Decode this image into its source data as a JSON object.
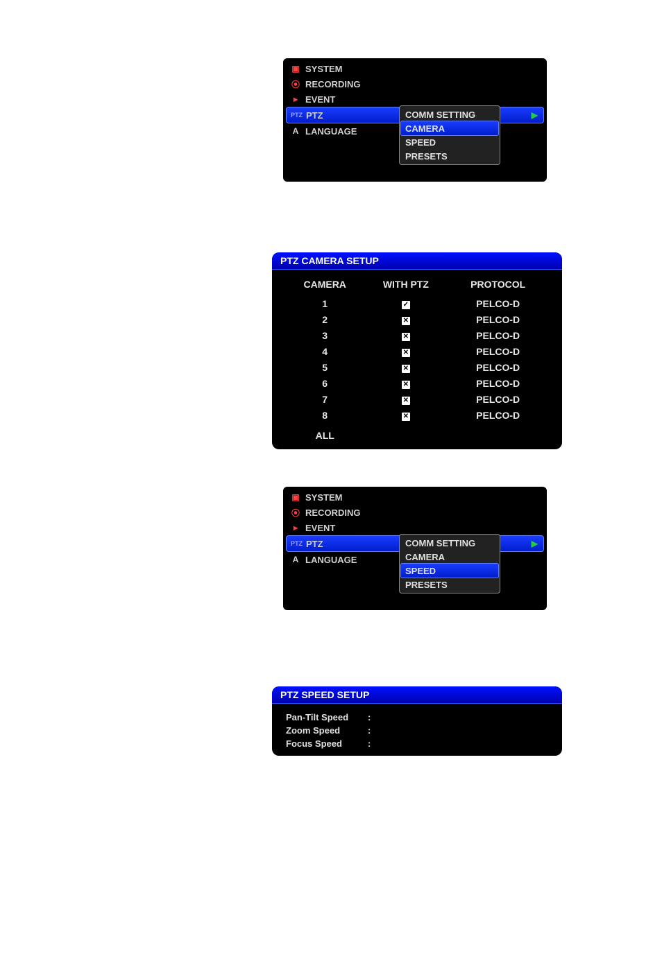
{
  "menu1": {
    "items": [
      {
        "label": "SYSTEM"
      },
      {
        "label": "RECORDING"
      },
      {
        "label": "EVENT"
      },
      {
        "label": "PTZ"
      },
      {
        "label": "LANGUAGE"
      }
    ],
    "submenu": [
      {
        "label": "COMM SETTING"
      },
      {
        "label": "CAMERA"
      },
      {
        "label": "SPEED"
      },
      {
        "label": "PRESETS"
      }
    ]
  },
  "camera_setup": {
    "title": "PTZ CAMERA SETUP",
    "headers": {
      "camera": "CAMERA",
      "with": "WITH PTZ",
      "protocol": "PROTOCOL"
    },
    "rows": [
      {
        "cam": "1",
        "with": "✓",
        "protocol": "PELCO-D"
      },
      {
        "cam": "2",
        "with": "✕",
        "protocol": "PELCO-D"
      },
      {
        "cam": "3",
        "with": "✕",
        "protocol": "PELCO-D"
      },
      {
        "cam": "4",
        "with": "✕",
        "protocol": "PELCO-D"
      },
      {
        "cam": "5",
        "with": "✕",
        "protocol": "PELCO-D"
      },
      {
        "cam": "6",
        "with": "✕",
        "protocol": "PELCO-D"
      },
      {
        "cam": "7",
        "with": "✕",
        "protocol": "PELCO-D"
      },
      {
        "cam": "8",
        "with": "✕",
        "protocol": "PELCO-D"
      }
    ],
    "all": "ALL"
  },
  "menu2": {
    "items": [
      {
        "label": "SYSTEM"
      },
      {
        "label": "RECORDING"
      },
      {
        "label": "EVENT"
      },
      {
        "label": "PTZ"
      },
      {
        "label": "LANGUAGE"
      }
    ],
    "submenu": [
      {
        "label": "COMM SETTING"
      },
      {
        "label": "CAMERA"
      },
      {
        "label": "SPEED"
      },
      {
        "label": "PRESETS"
      }
    ]
  },
  "speed_setup": {
    "title": "PTZ SPEED SETUP",
    "rows": [
      {
        "label": "Pan-Tilt Speed",
        "sep": ":"
      },
      {
        "label": "Zoom Speed",
        "sep": ":"
      },
      {
        "label": "Focus Speed",
        "sep": ":"
      }
    ]
  }
}
